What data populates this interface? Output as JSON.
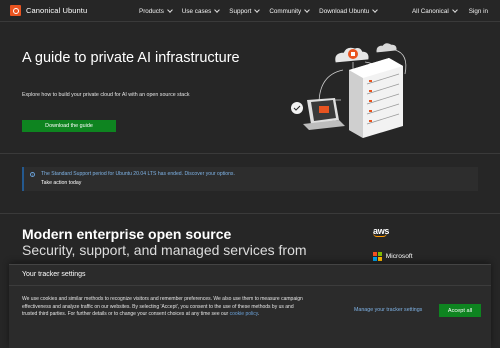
{
  "nav": {
    "brand": "Canonical Ubuntu",
    "items": [
      {
        "label": "Products"
      },
      {
        "label": "Use cases"
      },
      {
        "label": "Support"
      },
      {
        "label": "Community"
      },
      {
        "label": "Download Ubuntu"
      }
    ],
    "right": {
      "all_canonical": "All Canonical",
      "sign_in": "Sign in"
    }
  },
  "hero": {
    "title": "A guide to private AI infrastructure",
    "subtitle": "Explore how to build your private cloud for AI with an open source stack",
    "cta": "Download the guide"
  },
  "notice": {
    "message": "The Standard Support period for Ubuntu 20.04 LTS has ended. Discover your options.",
    "action": "Take action today"
  },
  "section": {
    "title": "Modern enterprise open source",
    "subtitle": "Security, support, and managed services from",
    "partners": {
      "aws": "aws",
      "microsoft": "Microsoft"
    }
  },
  "cookie": {
    "title": "Your tracker settings",
    "body": "We use cookies and similar methods to recognize visitors and remember preferences. We also use them to measure campaign effectiveness and analyze traffic on our websites. By selecting 'Accept', you consent to the use of these methods by us and trusted third parties. For further details or to change your consent choices at any time see our",
    "policy_link": "cookie policy",
    "manage": "Manage your tracker settings",
    "accept": "Accept all"
  },
  "colors": {
    "background": "#262626",
    "ubuntu_orange": "#e95420",
    "button_green": "#0e8420",
    "info_blue": "#24598f"
  }
}
